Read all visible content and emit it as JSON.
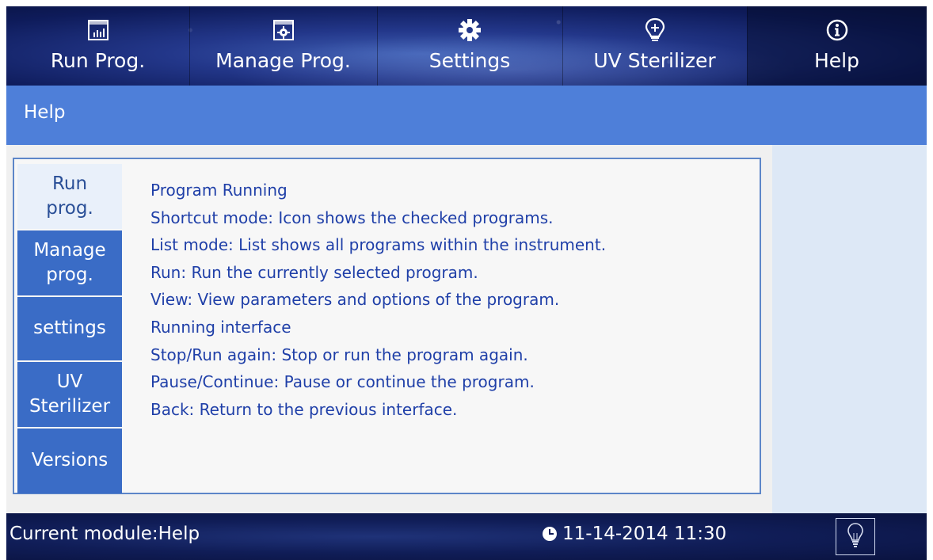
{
  "nav": {
    "items": [
      {
        "label": "Run Prog.",
        "icon": "bar-chart-icon"
      },
      {
        "label": "Manage Prog.",
        "icon": "gear-box-icon"
      },
      {
        "label": "Settings",
        "icon": "gear-icon"
      },
      {
        "label": "UV Sterilizer",
        "icon": "bulb-plus-icon"
      },
      {
        "label": "Help",
        "icon": "info-icon"
      }
    ],
    "active": "Help"
  },
  "page_title": "Help",
  "side_menu": {
    "items": [
      {
        "label": "Run\nprog."
      },
      {
        "label": "Manage\nprog."
      },
      {
        "label": "settings"
      },
      {
        "label": "UV\nSterilizer"
      },
      {
        "label": "Versions"
      }
    ],
    "active_index": 0
  },
  "help_lines": [
    "Program Running",
    "Shortcut mode: Icon shows the checked programs.",
    "List mode: List shows all programs within the instrument.",
    "Run: Run the currently selected program.",
    "View: View parameters and options of the program.",
    "Running interface",
    "Stop/Run again: Stop or run the program again.",
    "Pause/Continue: Pause or continue the program.",
    "Back: Return to the previous interface."
  ],
  "status": {
    "module": "Current module:Help",
    "datetime": "11-14-2014 11:30",
    "clock_icon": "clock-icon",
    "bulb_icon": "bulb-icon"
  },
  "colors": {
    "title_bar": "#4e7fd9",
    "side_menu": "#3a6cc6",
    "help_text": "#1f3fa8",
    "right_panel": "#dde8f6"
  }
}
